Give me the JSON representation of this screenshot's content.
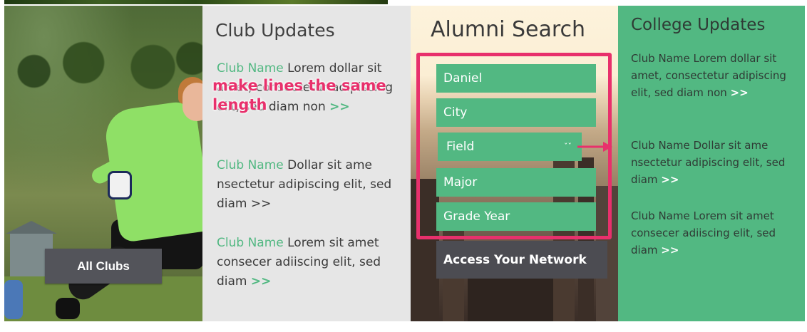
{
  "photo_panel": {
    "button_label": "All Clubs"
  },
  "club_updates": {
    "title": "Club Updates",
    "items": [
      {
        "club": "Club Name",
        "text": "Lorem dollar sit amet, consectetur adipiscing elit, sed diam non",
        "more": ">>"
      },
      {
        "club": "Club Name",
        "text": "Dollar sit ame nsectetur adipiscing elit, sed diam",
        "more": ">>"
      },
      {
        "club": "Club Name",
        "text": "Lorem sit amet consecer adiiscing elit, sed diam",
        "more": ">>"
      }
    ]
  },
  "annotation": {
    "text_line1": "make lines the same",
    "text_line2": "length",
    "color": "#e8306c"
  },
  "alumni_search": {
    "title": "Alumni Search",
    "fields": {
      "name": "Daniel",
      "city": "City",
      "field": "Field",
      "major": "Major",
      "grade_year": "Grade Year"
    },
    "dropdown_icon": "chevron-down-icon",
    "button_label": "Access Your Network"
  },
  "college_updates": {
    "title": "College Updates",
    "items": [
      {
        "text": "Club Name Lorem dollar sit amet, consectetur adipiscing elit, sed diam non",
        "more": ">>"
      },
      {
        "text": "Club Name Dollar sit ame nsectetur adipiscing elit, sed diam",
        "more": ">>"
      },
      {
        "text": "Club Name Lorem sit amet consecer adiiscing elit, sed diam",
        "more": ">>"
      }
    ]
  },
  "colors": {
    "accent_green": "#52b882",
    "dark_button": "#4c4c52",
    "light_panel": "#e6e6e6"
  }
}
